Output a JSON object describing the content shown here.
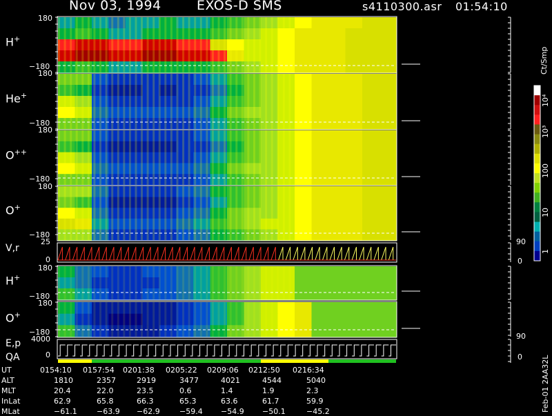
{
  "header": {
    "date": "Nov 03, 1994",
    "instrument": "EXOS-D SMS",
    "file": "s4110300.asr",
    "time": "01:54:10"
  },
  "panels": [
    {
      "id": "h1",
      "species": "H",
      "charge": "+",
      "ymax": "180",
      "ymin": "−180"
    },
    {
      "id": "he",
      "species": "He",
      "charge": "+",
      "ymax": "180",
      "ymin": "−180"
    },
    {
      "id": "opp",
      "species": "O",
      "charge": "++",
      "ymax": "180",
      "ymin": "−180"
    },
    {
      "id": "o1",
      "species": "O",
      "charge": "+",
      "ymax": "180",
      "ymin": "−180"
    },
    {
      "id": "vr",
      "species": "V,r",
      "charge": "",
      "ymax": "25",
      "ymin": "0",
      "rmax": "90",
      "rmin": "0"
    },
    {
      "id": "h2",
      "species": "H",
      "charge": "+",
      "ymax": "180",
      "ymin": "−180"
    },
    {
      "id": "o2",
      "species": "O",
      "charge": "+",
      "ymax": "180",
      "ymin": "−180",
      "rmax": "90"
    },
    {
      "id": "ep",
      "species": "E,p",
      "charge": "",
      "ymax": "4000",
      "ymin": "0",
      "rmin": "0"
    }
  ],
  "qa_label": "QA",
  "colorbar": {
    "unit": "Ct/Smp",
    "labels": [
      "10⁴",
      "10³",
      "100",
      "10",
      "1"
    ],
    "colors": [
      "#ffffff",
      "#a00000",
      "#d01010",
      "#ff2020",
      "#6a5a10",
      "#8a8a10",
      "#b0b000",
      "#e0e000",
      "#ffff00",
      "#c0e020",
      "#80d000",
      "#40b020",
      "#008040",
      "#006040",
      "#00b0b0",
      "#0060a0",
      "#0040c0",
      "#000090"
    ]
  },
  "footer": {
    "rows": [
      {
        "label": "UT",
        "values": [
          "0154:10",
          "0157:54",
          "0201:38",
          "0205:22",
          "0209:06",
          "0212:50",
          "0216:34"
        ]
      },
      {
        "label": "ALT",
        "values": [
          "1810",
          "2357",
          "2919",
          "3477",
          "4021",
          "4544",
          "5040"
        ]
      },
      {
        "label": "MLT",
        "values": [
          "20.4",
          "22.0",
          "23.5",
          "0.6",
          "1.4",
          "1.9",
          "2.3"
        ]
      },
      {
        "label": "InLat",
        "values": [
          "62.9",
          "65.8",
          "66.3",
          "65.3",
          "63.6",
          "61.7",
          "59.9"
        ]
      },
      {
        "label": "MLat",
        "values": [
          "−61.1",
          "−63.9",
          "−62.9",
          "−59.4",
          "−54.9",
          "−50.1",
          "−45.2"
        ]
      }
    ],
    "side_label": "Feb-01 2AA32L"
  },
  "chart_data": {
    "type": "heatmap",
    "title": "Nov 03, 1994   EXOS-D SMS",
    "x_ticks": [
      "0154:10",
      "0157:54",
      "0201:38",
      "0205:22",
      "0209:06",
      "0212:50",
      "0216:34"
    ],
    "ylim": [
      -180,
      180
    ],
    "series": [
      {
        "name": "H+",
        "rows": [
          [
            5,
            6,
            5,
            4,
            5,
            5,
            6,
            5,
            5,
            6,
            7,
            8,
            9,
            10,
            11,
            12,
            12,
            12,
            13,
            13
          ],
          [
            6,
            7,
            6,
            5,
            5,
            6,
            6,
            6,
            6,
            7,
            8,
            9,
            10,
            11,
            12,
            12,
            12,
            13,
            13,
            13
          ],
          [
            14,
            15,
            15,
            14,
            14,
            15,
            15,
            14,
            14,
            13,
            11,
            10,
            10,
            11,
            12,
            12,
            12,
            13,
            13,
            13
          ],
          [
            15,
            16,
            16,
            15,
            15,
            16,
            16,
            15,
            15,
            14,
            12,
            10,
            10,
            11,
            12,
            12,
            12,
            13,
            13,
            13
          ],
          [
            6,
            7,
            6,
            5,
            5,
            6,
            6,
            6,
            6,
            7,
            8,
            9,
            10,
            11,
            12,
            12,
            12,
            13,
            13,
            13
          ]
        ]
      },
      {
        "name": "He+",
        "rows": [
          [
            8,
            8,
            3,
            2,
            2,
            2,
            2,
            2,
            3,
            5,
            7,
            8,
            9,
            10,
            11,
            12,
            12,
            12,
            13,
            13
          ],
          [
            7,
            6,
            2,
            1,
            1,
            2,
            1,
            2,
            2,
            4,
            6,
            8,
            9,
            10,
            11,
            12,
            12,
            12,
            13,
            13
          ],
          [
            10,
            9,
            3,
            2,
            2,
            2,
            2,
            2,
            3,
            5,
            7,
            8,
            9,
            10,
            11,
            12,
            12,
            12,
            13,
            13
          ],
          [
            11,
            10,
            4,
            3,
            3,
            3,
            3,
            3,
            4,
            6,
            8,
            9,
            9,
            10,
            11,
            12,
            12,
            12,
            13,
            13
          ],
          [
            8,
            8,
            3,
            2,
            2,
            2,
            2,
            2,
            3,
            5,
            7,
            8,
            9,
            10,
            11,
            12,
            12,
            12,
            13,
            13
          ]
        ]
      },
      {
        "name": "O++",
        "rows": [
          [
            8,
            8,
            3,
            2,
            2,
            2,
            2,
            2,
            3,
            5,
            7,
            8,
            9,
            10,
            11,
            12,
            12,
            12,
            13,
            13
          ],
          [
            7,
            6,
            2,
            1,
            1,
            1,
            1,
            2,
            2,
            4,
            6,
            8,
            9,
            10,
            11,
            12,
            12,
            12,
            13,
            13
          ],
          [
            10,
            9,
            3,
            2,
            2,
            2,
            2,
            2,
            3,
            5,
            7,
            8,
            9,
            10,
            11,
            12,
            12,
            12,
            13,
            13
          ],
          [
            11,
            10,
            4,
            3,
            3,
            3,
            3,
            3,
            4,
            6,
            8,
            9,
            9,
            10,
            11,
            12,
            12,
            12,
            13,
            13
          ],
          [
            8,
            8,
            3,
            2,
            2,
            2,
            2,
            2,
            3,
            5,
            7,
            8,
            9,
            10,
            11,
            12,
            12,
            12,
            13,
            13
          ]
        ]
      },
      {
        "name": "O+",
        "rows": [
          [
            9,
            9,
            4,
            2,
            2,
            2,
            2,
            3,
            4,
            6,
            7,
            8,
            9,
            10,
            11,
            12,
            12,
            12,
            13,
            13
          ],
          [
            8,
            7,
            3,
            1,
            1,
            1,
            1,
            2,
            3,
            5,
            7,
            8,
            9,
            10,
            11,
            12,
            12,
            12,
            13,
            13
          ],
          [
            11,
            10,
            4,
            2,
            2,
            2,
            2,
            3,
            4,
            6,
            8,
            9,
            9,
            10,
            11,
            12,
            12,
            12,
            13,
            13
          ],
          [
            13,
            12,
            5,
            3,
            3,
            3,
            3,
            4,
            5,
            7,
            8,
            9,
            10,
            10,
            11,
            12,
            12,
            12,
            13,
            13
          ],
          [
            9,
            9,
            4,
            2,
            2,
            2,
            2,
            3,
            4,
            6,
            7,
            8,
            9,
            10,
            11,
            12,
            12,
            12,
            13,
            13
          ]
        ]
      },
      {
        "name": "H+ (lower)",
        "rows": [
          [
            6,
            4,
            3,
            2,
            2,
            3,
            3,
            4,
            5,
            7,
            8,
            9,
            10,
            10,
            8,
            8,
            8,
            8,
            8,
            8
          ],
          [
            5,
            4,
            2,
            2,
            2,
            2,
            3,
            4,
            5,
            7,
            8,
            9,
            10,
            10,
            8,
            8,
            8,
            8,
            8,
            8
          ],
          [
            7,
            5,
            3,
            2,
            2,
            3,
            3,
            4,
            5,
            7,
            8,
            9,
            10,
            10,
            8,
            8,
            8,
            8,
            8,
            8
          ]
        ]
      },
      {
        "name": "O+ (lower)",
        "rows": [
          [
            6,
            3,
            1,
            1,
            1,
            1,
            1,
            2,
            3,
            5,
            7,
            9,
            10,
            11,
            12,
            8,
            8,
            8,
            8,
            8
          ],
          [
            5,
            2,
            1,
            0,
            0,
            1,
            1,
            2,
            3,
            5,
            7,
            9,
            10,
            11,
            12,
            8,
            8,
            8,
            8,
            8
          ],
          [
            7,
            4,
            2,
            1,
            1,
            1,
            2,
            3,
            4,
            6,
            8,
            9,
            10,
            11,
            12,
            8,
            8,
            8,
            8,
            8
          ]
        ]
      }
    ]
  }
}
